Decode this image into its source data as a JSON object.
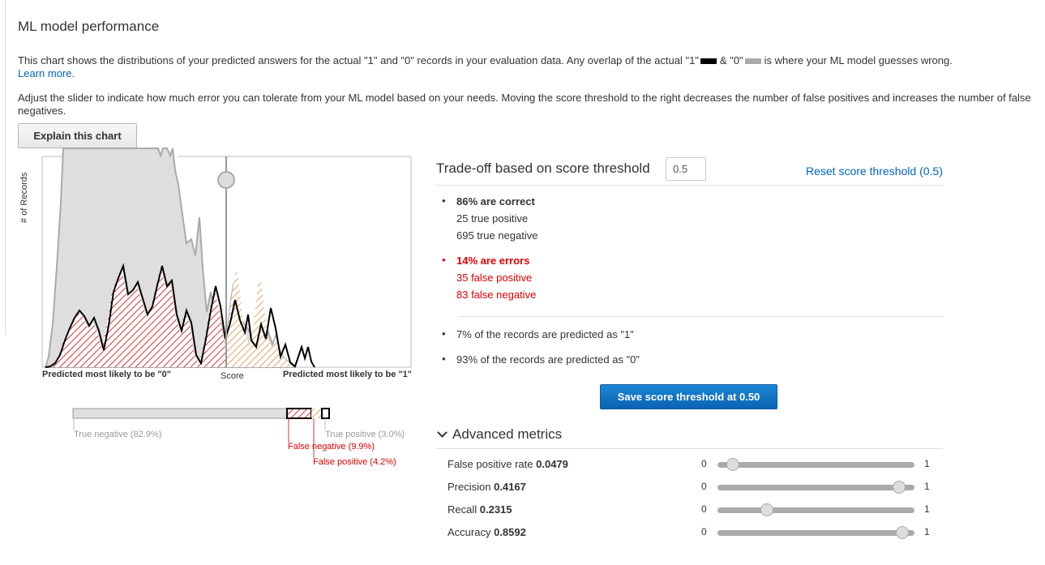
{
  "header": {
    "title": "ML model performance",
    "desc_main": "This chart shows the distributions of your predicted answers for the actual \"1\" and \"0\" records in your evaluation data. Any overlap of the actual \"1\"",
    "desc_and": "& \"0\"",
    "desc_tail": "is where your ML model guesses wrong.",
    "learn_more": "Learn more.",
    "desc2": "Adjust the slider to indicate how much error you can tolerate from your ML model based on your needs. Moving the score threshold to the right decreases the number of false positives and increases the number of false negatives.",
    "explain_button": "Explain this chart"
  },
  "colors": {
    "actual1": "#000000",
    "actual0": "#aaaaaa",
    "error": "#dd0000",
    "primary": "#0a63b2"
  },
  "chart": {
    "y_axis_label": "# of Records",
    "x_left_label": "Predicted most likely to be \"0\"",
    "x_center_label": "Score",
    "x_right_label": "Predicted most likely to be \"1\"",
    "threshold": 0.5,
    "bar": {
      "true_negative": "True negative (82.9%)",
      "false_negative": "False negative (9.9%)",
      "false_positive": "False positive (4.2%)",
      "true_positive": "True positive (3.0%)"
    }
  },
  "tradeoff": {
    "title": "Trade-off based on score threshold",
    "threshold_value": "0.5",
    "reset_link": "Reset score threshold (0.5)",
    "correct_title": "86% are correct",
    "true_positive": "25 true positive",
    "true_negative": "695 true negative",
    "errors_title": "14% are errors",
    "false_positive": "35 false positive",
    "false_negative": "83 false negative",
    "predicted_1": "7% of the records are predicted as \"1\"",
    "predicted_0": "93% of the records are predicted as \"0\"",
    "save_button": "Save score threshold at 0.50"
  },
  "advanced": {
    "title": "Advanced metrics",
    "min": "0",
    "max": "1",
    "metrics": [
      {
        "label": "False positive rate",
        "value": "0.0479",
        "level": 0.0479
      },
      {
        "label": "Precision",
        "value": "0.4167",
        "level": 0.95
      },
      {
        "label": "Recall",
        "value": "0.2315",
        "level": 0.2315
      },
      {
        "label": "Accuracy",
        "value": "0.8592",
        "level": 0.97
      }
    ]
  }
}
